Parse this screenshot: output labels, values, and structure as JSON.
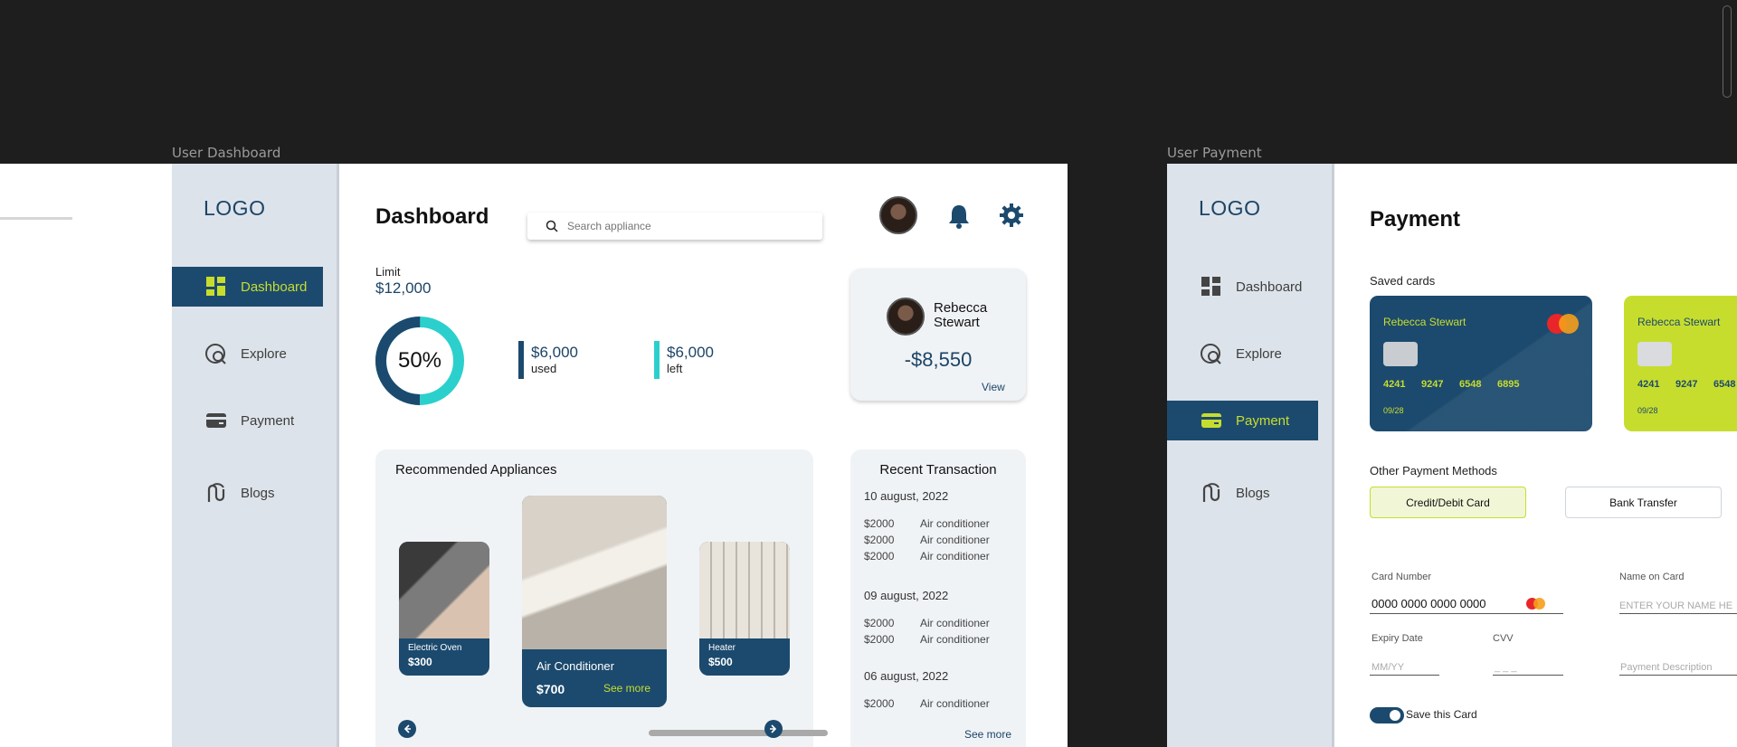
{
  "frames": {
    "dashboard_label": "User Dashboard",
    "payment_label": "User Payment"
  },
  "colors": {
    "primary": "#1c4a6e",
    "accent": "#c7dd2e",
    "teal": "#2bd0cc",
    "sidebar_bg": "#dde3ea"
  },
  "dashboard": {
    "logo": "LOGO",
    "nav": [
      {
        "label": "Dashboard",
        "icon": "dashboard-icon",
        "active": true
      },
      {
        "label": "Explore",
        "icon": "explore-icon",
        "active": false
      },
      {
        "label": "Payment",
        "icon": "wallet-icon",
        "active": false
      },
      {
        "label": "Blogs",
        "icon": "blogs-icon",
        "active": false
      }
    ],
    "title": "Dashboard",
    "search_placeholder": "Search appliance",
    "limit": {
      "label": "Limit",
      "amount": "$12,000",
      "percent_text": "50%",
      "percent_value": 0.5,
      "used_amount": "$6,000",
      "used_label": "used",
      "left_amount": "$6,000",
      "left_label": "left"
    },
    "profile": {
      "name": "Rebecca Stewart",
      "balance": "-$8,550",
      "view": "View"
    },
    "recommended": {
      "title": "Recommended Appliances",
      "items": [
        {
          "name": "Electric Oven",
          "price": "$300"
        },
        {
          "name": "Air Conditioner",
          "price": "$700",
          "cta": "See more"
        },
        {
          "name": "Heater",
          "price": "$500"
        }
      ]
    },
    "transactions": {
      "title": "Recent Transaction",
      "groups": [
        {
          "date": "10 august, 2022",
          "rows": [
            {
              "amount": "$2000",
              "item": "Air conditioner"
            },
            {
              "amount": "$2000",
              "item": "Air conditioner"
            },
            {
              "amount": "$2000",
              "item": "Air conditioner"
            }
          ]
        },
        {
          "date": "09 august, 2022",
          "rows": [
            {
              "amount": "$2000",
              "item": "Air conditioner"
            },
            {
              "amount": "$2000",
              "item": "Air conditioner"
            }
          ]
        },
        {
          "date": "06 august, 2022",
          "rows": [
            {
              "amount": "$2000",
              "item": "Air conditioner"
            }
          ]
        }
      ],
      "see_more": "See more"
    }
  },
  "payment": {
    "logo": "LOGO",
    "nav": [
      {
        "label": "Dashboard",
        "icon": "dashboard-icon",
        "active": false
      },
      {
        "label": "Explore",
        "icon": "explore-icon",
        "active": false
      },
      {
        "label": "Payment",
        "icon": "wallet-icon",
        "active": true
      },
      {
        "label": "Blogs",
        "icon": "blogs-icon",
        "active": false
      }
    ],
    "title": "Payment",
    "saved_cards_label": "Saved cards",
    "cards": [
      {
        "holder": "Rebecca Stewart",
        "number": [
          "4241",
          "9247",
          "6548",
          "6895"
        ],
        "expiry": "09/28",
        "color": "#1c4a6e"
      },
      {
        "holder": "Rebecca Stewart",
        "number": [
          "4241",
          "9247",
          "6548"
        ],
        "expiry": "09/28",
        "color": "#c7dd2e"
      }
    ],
    "other_methods_label": "Other Payment Methods",
    "method_buttons": [
      "Credit/Debit Card",
      "Bank Transfer"
    ],
    "form": {
      "card_number_label": "Card Number",
      "card_number_value": "0000  0000  0000  0000",
      "name_label": "Name on Card",
      "name_placeholder": "ENTER YOUR NAME HE",
      "expiry_label": "Expiry Date",
      "expiry_placeholder": "MM/YY",
      "cvv_label": "CVV",
      "cvv_placeholder": "_ _ _",
      "description_placeholder": "Payment Description",
      "save_card_label": "Save this Card"
    }
  }
}
